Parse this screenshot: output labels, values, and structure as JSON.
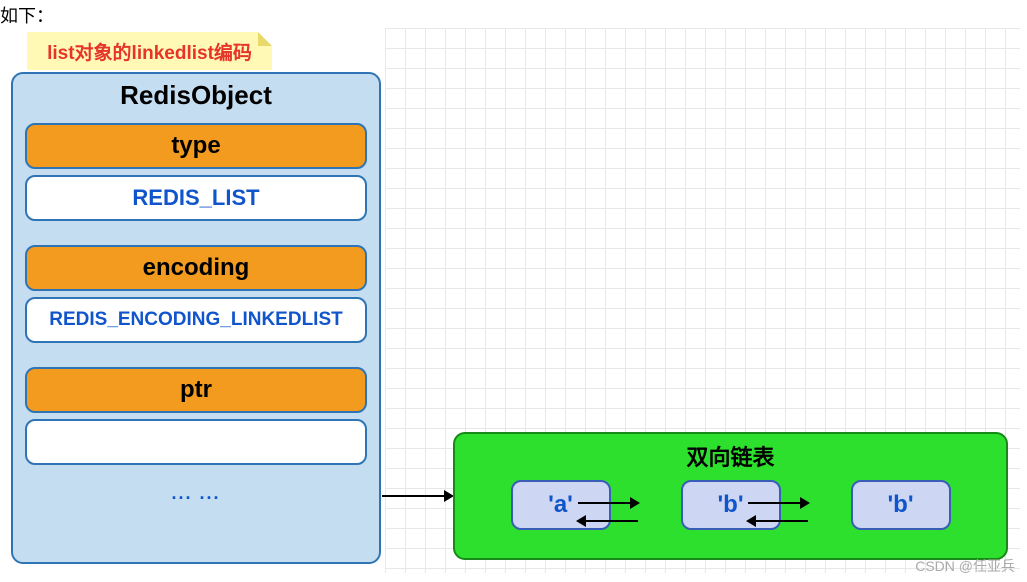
{
  "top_fragment": "如下：",
  "sticky_label": "list对象的linkedlist编码",
  "redis_object": {
    "title": "RedisObject",
    "type_header": "type",
    "type_value": "REDIS_LIST",
    "encoding_header": "encoding",
    "encoding_value": "REDIS_ENCODING_LINKEDLIST",
    "ptr_header": "ptr",
    "ptr_value": "",
    "dots": "... ..."
  },
  "linked_list": {
    "title": "双向链表",
    "nodes": [
      "'a'",
      "'b'",
      "'b'"
    ]
  },
  "watermark": "CSDN @任亚兵"
}
